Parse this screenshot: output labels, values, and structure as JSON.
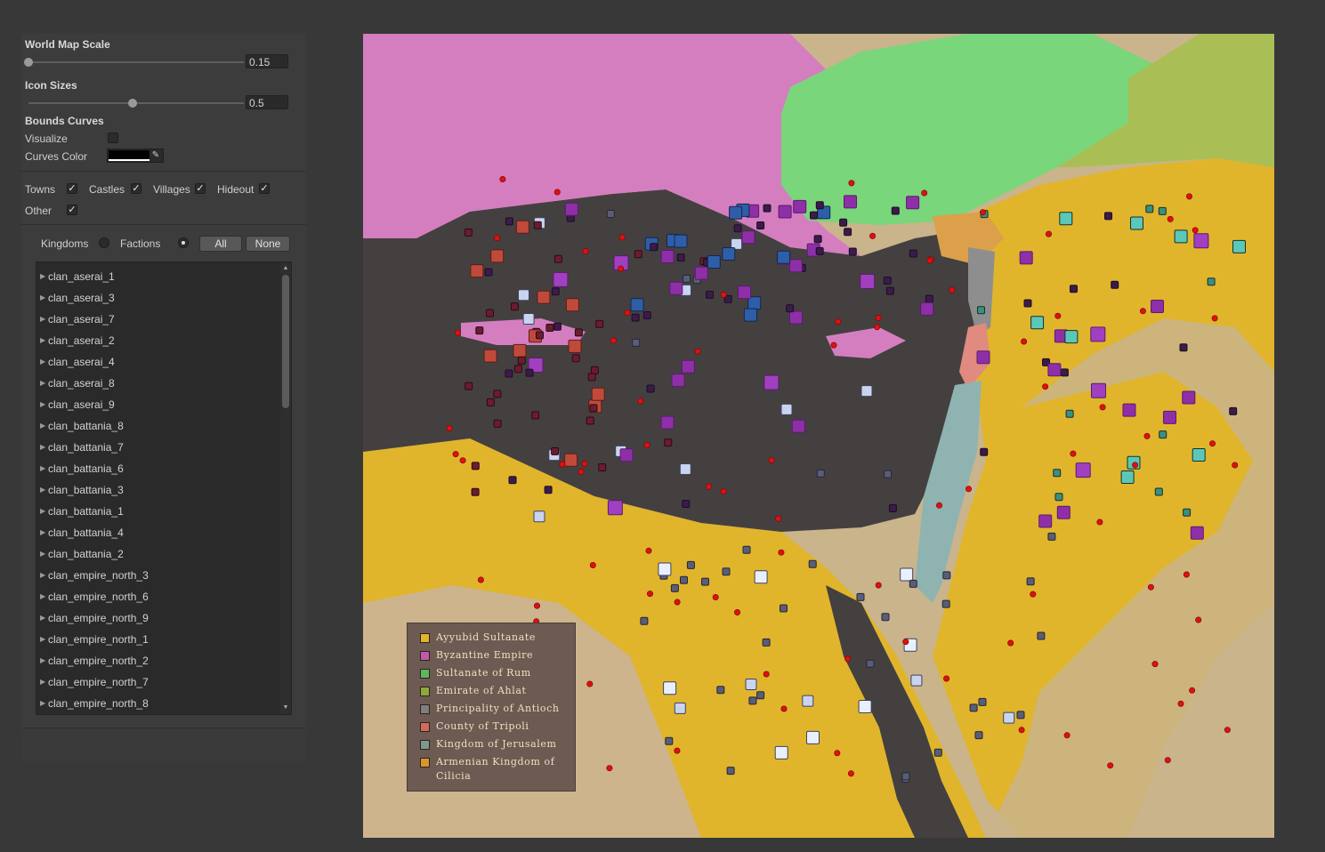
{
  "inspector": {
    "world_map_scale": {
      "label": "World Map Scale",
      "value": "0.15",
      "level": 0.0
    },
    "icon_sizes": {
      "label": "Icon Sizes",
      "value": "0.5",
      "level": 0.5
    },
    "bounds_curves": {
      "title": "Bounds Curves",
      "visualize_label": "Visualize",
      "visualize_checked": false,
      "curves_color_label": "Curves Color",
      "curves_color": "#000000"
    },
    "filters": [
      {
        "label": "Towns",
        "checked": true
      },
      {
        "label": "Castles",
        "checked": true
      },
      {
        "label": "Villages",
        "checked": true
      },
      {
        "label": "Hideout",
        "checked": true
      },
      {
        "label": "Other",
        "checked": true
      }
    ],
    "mode": {
      "kingdoms_label": "Kingdoms",
      "factions_label": "Factions",
      "selected": "Factions",
      "all_button": "All",
      "none_button": "None"
    },
    "clans": [
      "clan_aserai_1",
      "clan_aserai_3",
      "clan_aserai_7",
      "clan_aserai_2",
      "clan_aserai_4",
      "clan_aserai_8",
      "clan_aserai_9",
      "clan_battania_8",
      "clan_battania_7",
      "clan_battania_6",
      "clan_battania_3",
      "clan_battania_1",
      "clan_battania_4",
      "clan_battania_2",
      "clan_empire_north_3",
      "clan_empire_north_6",
      "clan_empire_north_9",
      "clan_empire_north_1",
      "clan_empire_north_2",
      "clan_empire_north_7",
      "clan_empire_north_8"
    ]
  },
  "map": {
    "legend": [
      {
        "name": "Ayyubid Sultanate",
        "color": "#e0b52c"
      },
      {
        "name": "Byzantine Empire",
        "color": "#c25aa8"
      },
      {
        "name": "Sultanate of Rum",
        "color": "#5cb85c"
      },
      {
        "name": "Emirate of Ahlat",
        "color": "#8fa83a"
      },
      {
        "name": "Principality of Antioch",
        "color": "#7e7e7e"
      },
      {
        "name": "County of Tripoli",
        "color": "#d06a5e"
      },
      {
        "name": "Kingdom of Jerusalem",
        "color": "#7a9a8c"
      },
      {
        "name": "Armenian Kingdom of Cilicia",
        "color": "#d9952c"
      }
    ],
    "colors": {
      "sea": "#444040",
      "desert": "#c9b48c",
      "byzantine": "#d47ec0",
      "rum": "#79d67a",
      "ahlat": "#a9bf55",
      "ayyubid": "#e0b52c",
      "jerusalem": "#8fb3b0",
      "tripoli": "#e08a80",
      "cilicia": "#dca04a"
    }
  }
}
